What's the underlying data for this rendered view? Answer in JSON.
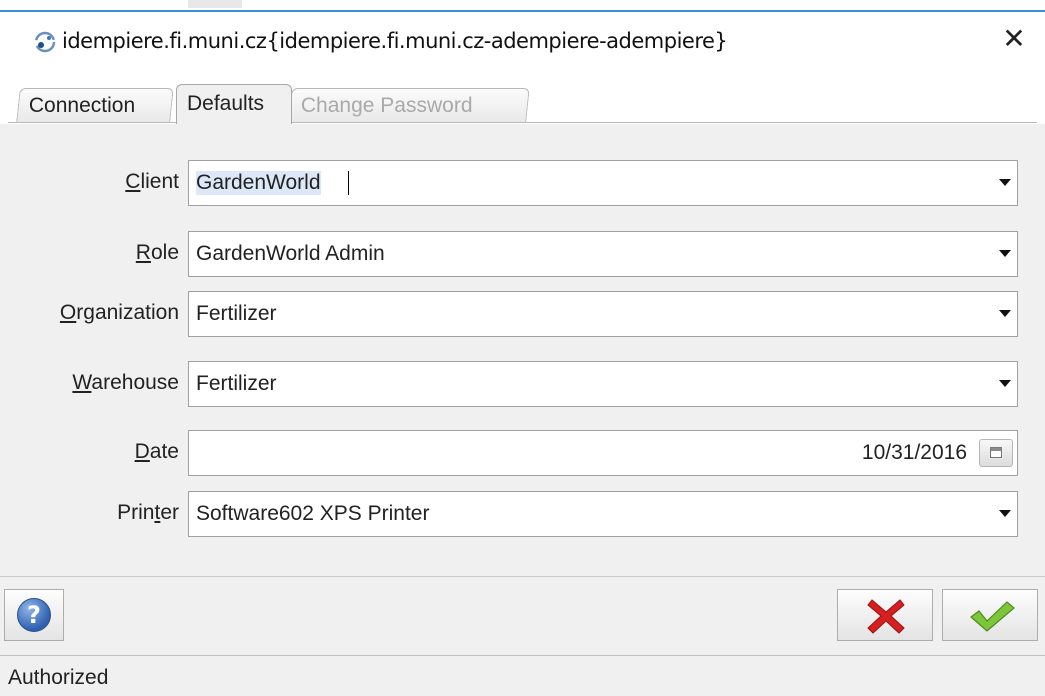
{
  "window": {
    "title": "idempiere.fi.muni.cz{idempiere.fi.muni.cz-adempiere-adempiere}",
    "close_glyph": "✕"
  },
  "tabs": [
    {
      "label": "Connection",
      "state": "normal"
    },
    {
      "label": "Defaults",
      "state": "selected"
    },
    {
      "label": "Change Password",
      "state": "disabled"
    }
  ],
  "form": {
    "client": {
      "mnemonic": "C",
      "label_rest": "lient",
      "value": "GardenWorld"
    },
    "role": {
      "mnemonic": "R",
      "label_rest": "ole",
      "value": "GardenWorld Admin"
    },
    "organization": {
      "mnemonic": "O",
      "label_rest": "rganization",
      "value": "Fertilizer"
    },
    "warehouse": {
      "mnemonic": "W",
      "label_rest": "arehouse",
      "value": "Fertilizer"
    },
    "date": {
      "mnemonic": "D",
      "label_rest": "ate",
      "value": "10/31/2016"
    },
    "printer": {
      "label_pre": "Prin",
      "mnemonic": "t",
      "label_rest": "er",
      "value": "Software602 XPS Printer"
    }
  },
  "buttons": {
    "help_glyph": "?"
  },
  "status": {
    "text": "Authorized"
  },
  "colors": {
    "accent_line": "#3c8ed8",
    "cancel_red": "#d42020",
    "ok_green": "#7cc63a",
    "selection": "#dce8f7"
  },
  "icons": {
    "title": "idempiere-logo-icon",
    "close": "close-icon",
    "dropdown": "chevron-down-icon",
    "calendar": "calendar-icon",
    "help": "help-icon",
    "cancel": "cancel-x-icon",
    "ok": "checkmark-icon"
  }
}
